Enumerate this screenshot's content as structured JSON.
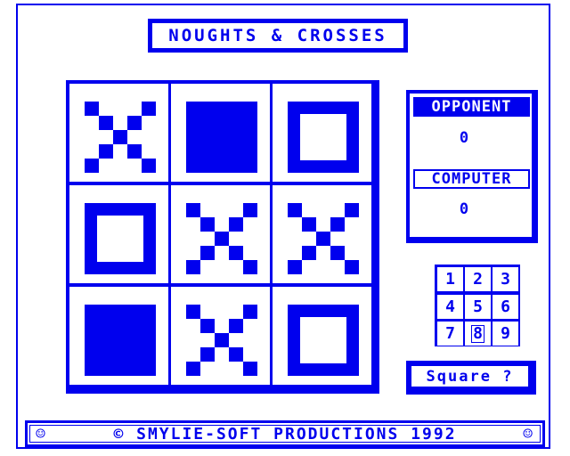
{
  "title": "NOUGHTS & CROSSES",
  "board": [
    "X",
    "■",
    "O",
    "O",
    "X",
    "X",
    "■",
    "X",
    "O"
  ],
  "scores": {
    "opponent_label": "OPPONENT",
    "opponent_score": "0",
    "computer_label": "COMPUTER",
    "computer_score": "0"
  },
  "keypad": [
    "1",
    "2",
    "3",
    "4",
    "5",
    "6",
    "7",
    "8",
    "9"
  ],
  "keypad_selected": "8",
  "prompt": "Square ?",
  "footer": {
    "left_icon": "☺",
    "text": "© SMYLIE-SOFT PRODUCTIONS 1992",
    "right_icon": "☺"
  },
  "colors": {
    "accent": "#0000ee",
    "background": "#ffffff"
  }
}
